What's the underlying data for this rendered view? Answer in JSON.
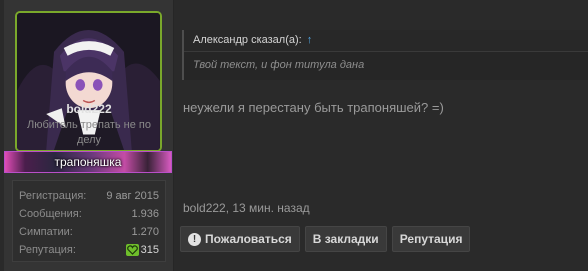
{
  "user": {
    "username": "bold222",
    "title": "Любитель трепать не по делу",
    "banner": "трапоняшка",
    "stats": [
      {
        "label": "Регистрация:",
        "value": "9 авг 2015"
      },
      {
        "label": "Сообщения:",
        "value": "1.936"
      },
      {
        "label": "Симпатии:",
        "value": "1.270"
      }
    ],
    "reputation": {
      "label": "Репутация:",
      "value": "315"
    }
  },
  "quote": {
    "author": "Александр сказал(а):",
    "arrow": "↑",
    "text": "Твой текст, и фон титула дана"
  },
  "message": "неужели я перестану быть трапоняшей? =)",
  "meta": "bold222, 13 мин. назад",
  "actions": {
    "report": "Пожаловаться",
    "bookmark": "В закладки",
    "reputation": "Репутация"
  },
  "colors": {
    "avatar_border": "#7aa82b",
    "rep_heart": "#6fbf2b",
    "quote_arrow": "#4fa3e0"
  }
}
